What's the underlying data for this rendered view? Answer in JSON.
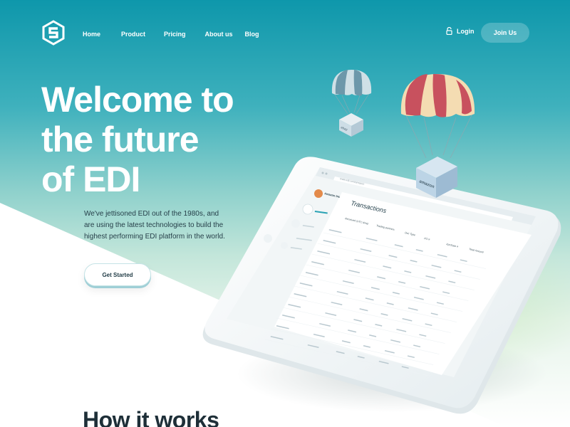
{
  "nav": {
    "links": [
      "Home",
      "Product",
      "Pricing",
      "About us",
      "Blog"
    ],
    "login": "Login",
    "join": "Join Us"
  },
  "hero": {
    "title_lines": [
      "Welcome to",
      "the future",
      "of EDI"
    ],
    "text": "We've jettisoned EDI out of the 1980s, and are using the latest technologies to build the highest performing EDI platform in the world.",
    "cta": "Get Started"
  },
  "how_it_works": "How it works",
  "illustration": {
    "crate_small_label": "ebay",
    "crate_big_label": "amazon",
    "browser_url": "www.edi.com/amazon",
    "company": "Amazon Inc",
    "panel_title": "Transactions",
    "columns": [
      "Received (UTC time)",
      "Trading partners",
      "Doc Type",
      "PO #",
      "Xpr/Date #",
      "Total Amount"
    ]
  },
  "colors": {
    "brand_teal": "#0e97ab",
    "text_dark": "#1e2f38",
    "balloon_red": "#c8515e",
    "balloon_cream": "#f4dcb2",
    "balloon_blue": "#6d98aa",
    "crate_blue": "#bcd4e6"
  }
}
